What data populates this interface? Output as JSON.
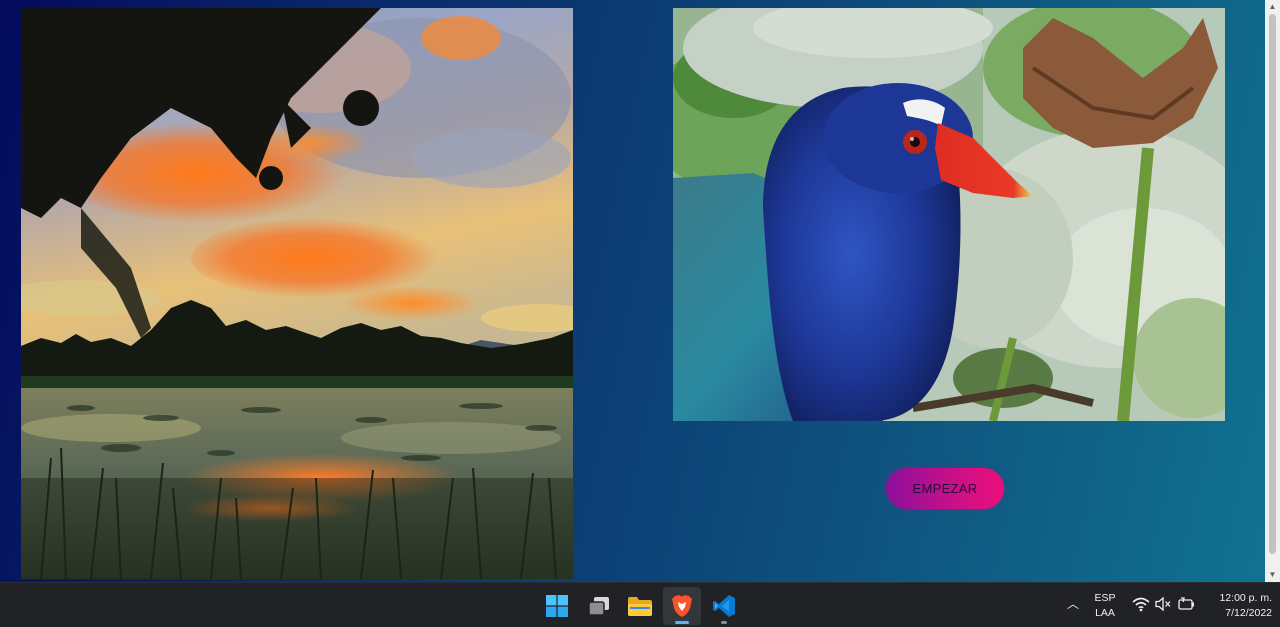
{
  "main": {
    "images": [
      {
        "name": "sunset-lake-photo"
      },
      {
        "name": "purple-gallinule-photo"
      }
    ],
    "start_button": {
      "label": "EMPEZAR",
      "colors": [
        "#8b0f99",
        "#ec0f7a"
      ]
    },
    "background_colors": [
      "#040b5c",
      "#11728f"
    ]
  },
  "taskbar": {
    "apps": [
      {
        "icon": "windows-start-icon",
        "active": false
      },
      {
        "icon": "task-view-icon",
        "active": false
      },
      {
        "icon": "file-explorer-icon",
        "active": false
      },
      {
        "icon": "brave-browser-icon",
        "active": true
      },
      {
        "icon": "vscode-icon",
        "active": false,
        "running": true
      }
    ],
    "tray": {
      "language_line1": "ESP",
      "language_line2": "LAA",
      "icons": [
        "chevron-up-icon",
        "wifi-icon",
        "speaker-muted-icon",
        "battery-charging-icon"
      ]
    },
    "clock": {
      "time": "12:00 p. m.",
      "date": "7/12/2022"
    }
  }
}
